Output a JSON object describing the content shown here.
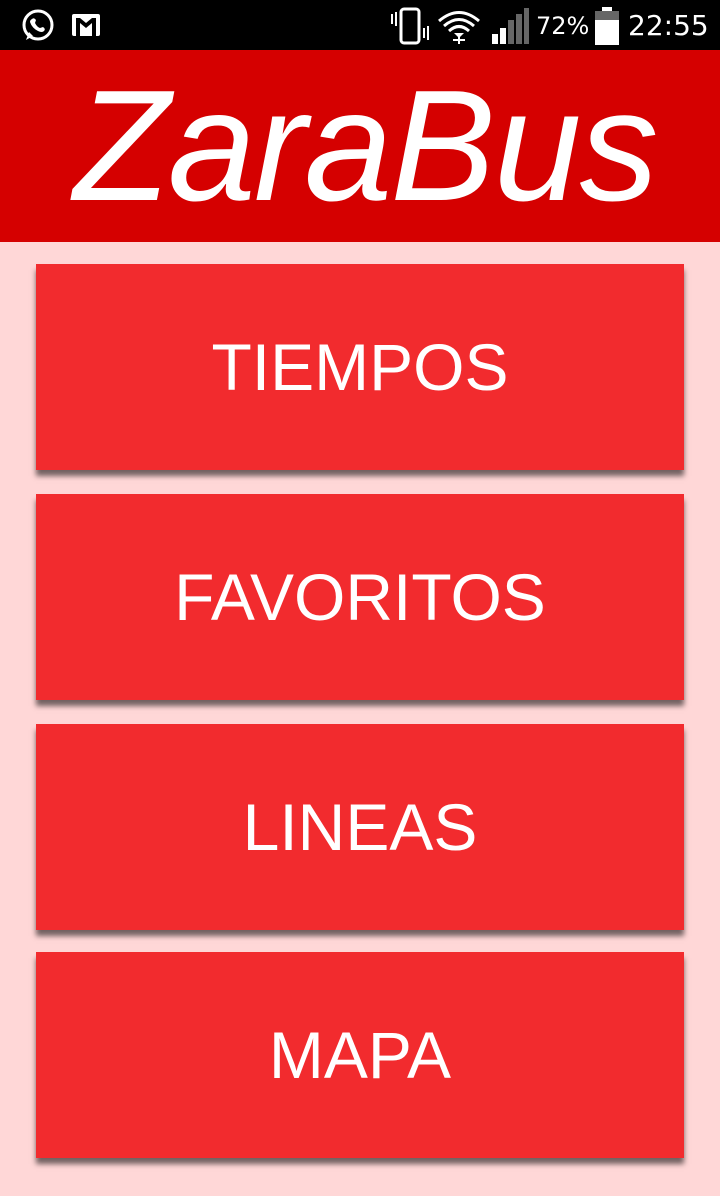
{
  "status_bar": {
    "icons": [
      "whatsapp-icon",
      "gmail-icon",
      "vibrate-icon",
      "wifi-icon",
      "signal-icon",
      "battery-icon"
    ],
    "battery_percent": "72%",
    "clock": "22:55"
  },
  "header": {
    "title": "ZaraBus",
    "color": "#d50000"
  },
  "menu": {
    "button_color": "#f22b2e",
    "background": "#ffd7d7",
    "items": [
      {
        "label": "TIEMPOS"
      },
      {
        "label": "FAVORITOS"
      },
      {
        "label": "LINEAS"
      },
      {
        "label": "MAPA"
      }
    ]
  }
}
